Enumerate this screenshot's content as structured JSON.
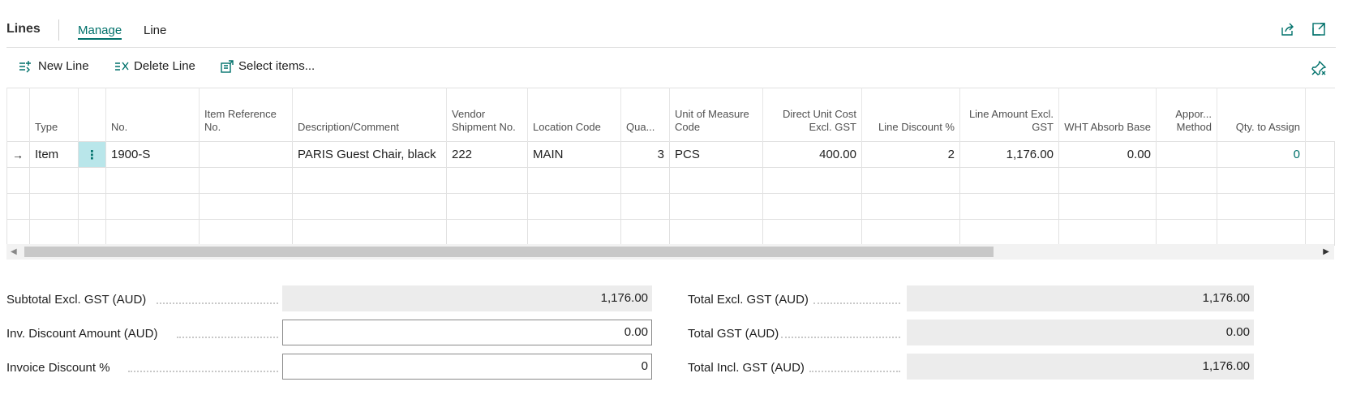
{
  "header": {
    "title": "Lines",
    "tabs": [
      {
        "label": "Manage",
        "active": true
      },
      {
        "label": "Line",
        "active": false
      }
    ]
  },
  "actions": {
    "new_line": "New Line",
    "delete_line": "Delete Line",
    "select_items": "Select items..."
  },
  "columns": [
    "Type",
    "",
    "No.",
    "Item Reference No.",
    "Description/Comment",
    "Vendor Shipment No.",
    "Location Code",
    "Qua...",
    "Unit of Measure Code",
    "Direct Unit Cost Excl. GST",
    "Line Discount %",
    "Line Amount Excl. GST",
    "WHT Absorb Base",
    "Appor... Method",
    "Qty. to Assign"
  ],
  "rows": [
    {
      "type": "Item",
      "no": "1900-S",
      "item_reference_no": "",
      "description": "PARIS Guest Chair, black",
      "vendor_shipment_no": "222",
      "location_code": "MAIN",
      "quantity": "3",
      "unit_of_measure": "PCS",
      "direct_unit_cost": "400.00",
      "line_discount": "2",
      "line_amount": "1,176.00",
      "wht_absorb_base": "0.00",
      "appor_method": "",
      "qty_to_assign": "0"
    }
  ],
  "totals_left": [
    {
      "label": "Subtotal Excl. GST (AUD)",
      "value": "1,176.00",
      "editable": false
    },
    {
      "label": "Inv. Discount Amount (AUD)",
      "value": "0.00",
      "editable": true
    },
    {
      "label": "Invoice Discount %",
      "value": "0",
      "editable": true
    }
  ],
  "totals_right": [
    {
      "label": "Total Excl. GST (AUD)",
      "value": "1,176.00",
      "editable": false
    },
    {
      "label": "Total GST (AUD)",
      "value": "0.00",
      "editable": false
    },
    {
      "label": "Total Incl. GST (AUD)",
      "value": "1,176.00",
      "editable": false
    }
  ],
  "colors": {
    "accent": "#00716b",
    "readonly_bg": "#ececec",
    "selected_cell_bg": "#b9e6ea"
  },
  "icons": [
    "share-icon",
    "expand-icon",
    "new-line-icon",
    "delete-line-icon",
    "select-items-icon",
    "personalize-pin-icon",
    "row-arrow-icon",
    "row-menu-icon"
  ]
}
